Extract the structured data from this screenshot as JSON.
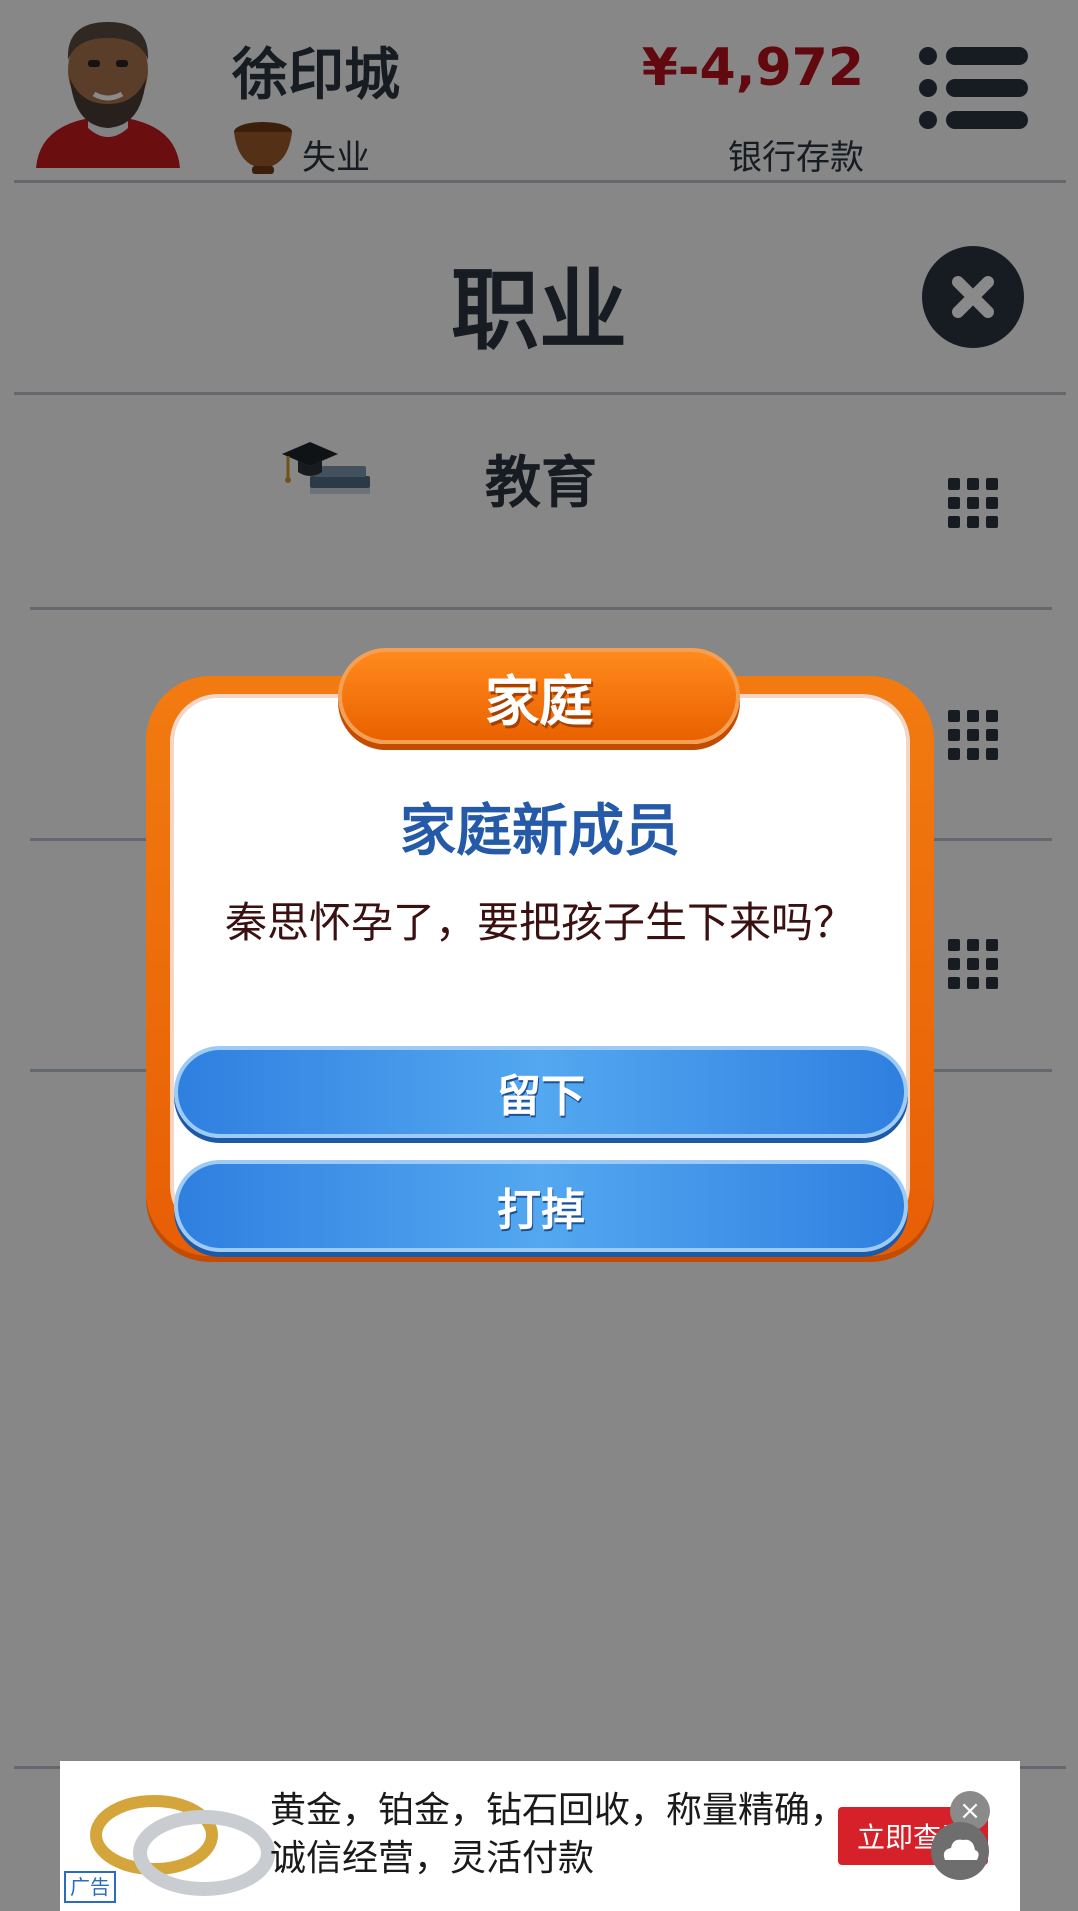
{
  "header": {
    "player_name": "徐印城",
    "job": "失业",
    "balance": "¥-4,972",
    "balance_label": "银行存款"
  },
  "section": {
    "title": "职业"
  },
  "rows": [
    {
      "label": "教育",
      "icon": "graduation-cap-icon"
    },
    {
      "label": "",
      "icon": ""
    },
    {
      "label": "",
      "icon": ""
    }
  ],
  "dialog": {
    "category": "家庭",
    "title": "家庭新成员",
    "message": "秦思怀孕了，要把孩子生下来吗？",
    "keep_label": "留下",
    "abort_label": "打掉"
  },
  "ad": {
    "tag": "广告",
    "text": "黄金，铂金，钻石回收，称量精确，诚信经营，灵活付款",
    "cta": "立即查看",
    "close": "×"
  },
  "colors": {
    "accent_orange": "#ea6100",
    "button_blue": "#2f7fe0",
    "balance_red": "#b3121b",
    "title_blue": "#255aa8"
  }
}
